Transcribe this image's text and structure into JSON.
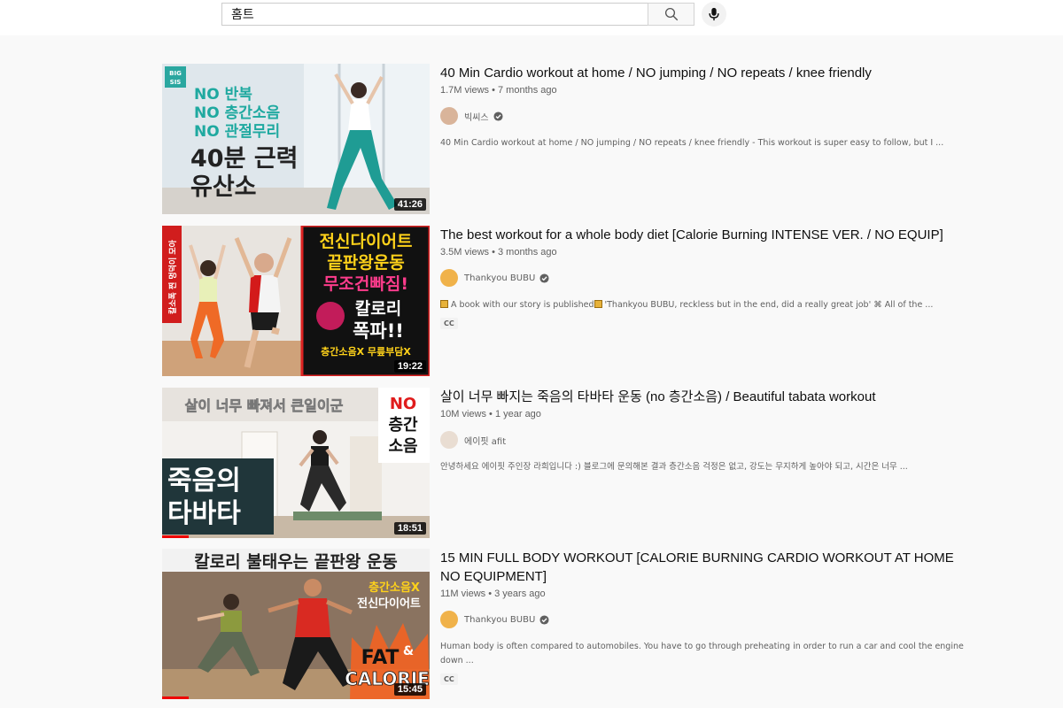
{
  "search": {
    "query": "홈트"
  },
  "videos": [
    {
      "title": "40 Min Cardio workout at home / NO jumping / NO repeats / knee friendly",
      "views": "1.7M views",
      "age": "7 months ago",
      "channel": "빅씨스",
      "verified": true,
      "description": "40 Min Cardio workout at home / NO jumping / NO repeats / knee friendly - This workout is super easy to follow, but I ...",
      "duration": "41:26",
      "cc": "",
      "thumb_text": {
        "badge": "BIG SIS",
        "line1": "NO 반복",
        "line2": "NO 층간소음",
        "line3": "NO 관절무리",
        "line4": "40분 근력",
        "line5": "유산소"
      }
    },
    {
      "title": "The best workout for a whole body diet [Calorie Burning INTENSE VER. / NO EQUIP]",
      "views": "3.5M views",
      "age": "3 months ago",
      "channel": "Thankyou BUBU",
      "verified": true,
      "description_prefix": " A book with our story is published",
      "description_suffix": " 'Thankyou BUBU, reckless but in the end, did a really great job' ⌘ All of the ...",
      "duration": "19:22",
      "cc": "CC",
      "thumb_text": {
        "side": "칼소폭 찐 멍덕이 모아",
        "line1": "전신다이어트",
        "line2": "끝판왕운동",
        "line3": "무조건빠짐!",
        "line4": "칼로리",
        "line5": "폭파!!",
        "line6": "층간소음X 무릎부담X"
      }
    },
    {
      "title": "살이 너무 빠지는 죽음의 타바타 운동 (no 층간소음) / Beautiful tabata workout",
      "views": "10M views",
      "age": "1 year ago",
      "channel": "에이핏 afit",
      "verified": false,
      "description": "안녕하세요 에이핏 주인장 라희입니다 :) 블로그에 문의해본 결과 층간소음 걱정은 없고, 강도는 무지하게 높아야 되고, 시간은 너무 ...",
      "duration": "18:51",
      "cc": "",
      "progress": 0.1,
      "thumb_text": {
        "top": "살이 너무 빠져서 큰일이군",
        "no1": "NO",
        "no2": "층간",
        "no3": "소음",
        "line1": "죽음의",
        "line2": "타바타"
      }
    },
    {
      "title": "15 MIN FULL BODY WORKOUT [CALORIE BURNING CARDIO WORKOUT AT HOME NO EQUIPMENT]",
      "views": "11M views",
      "age": "3 years ago",
      "channel": "Thankyou BUBU",
      "verified": true,
      "description": "Human body is often compared to automobiles. You have to go through preheating in order to run a car and cool the engine down ...",
      "duration": "15:45",
      "cc": "CC",
      "progress": 0.1,
      "thumb_text": {
        "top": "칼로리 불태우는 끝판왕 운동",
        "r1": "층간소음X",
        "r2": "전신다이어트",
        "fat": "FAT",
        "amp": "&",
        "cal": "CALORIE"
      }
    }
  ]
}
